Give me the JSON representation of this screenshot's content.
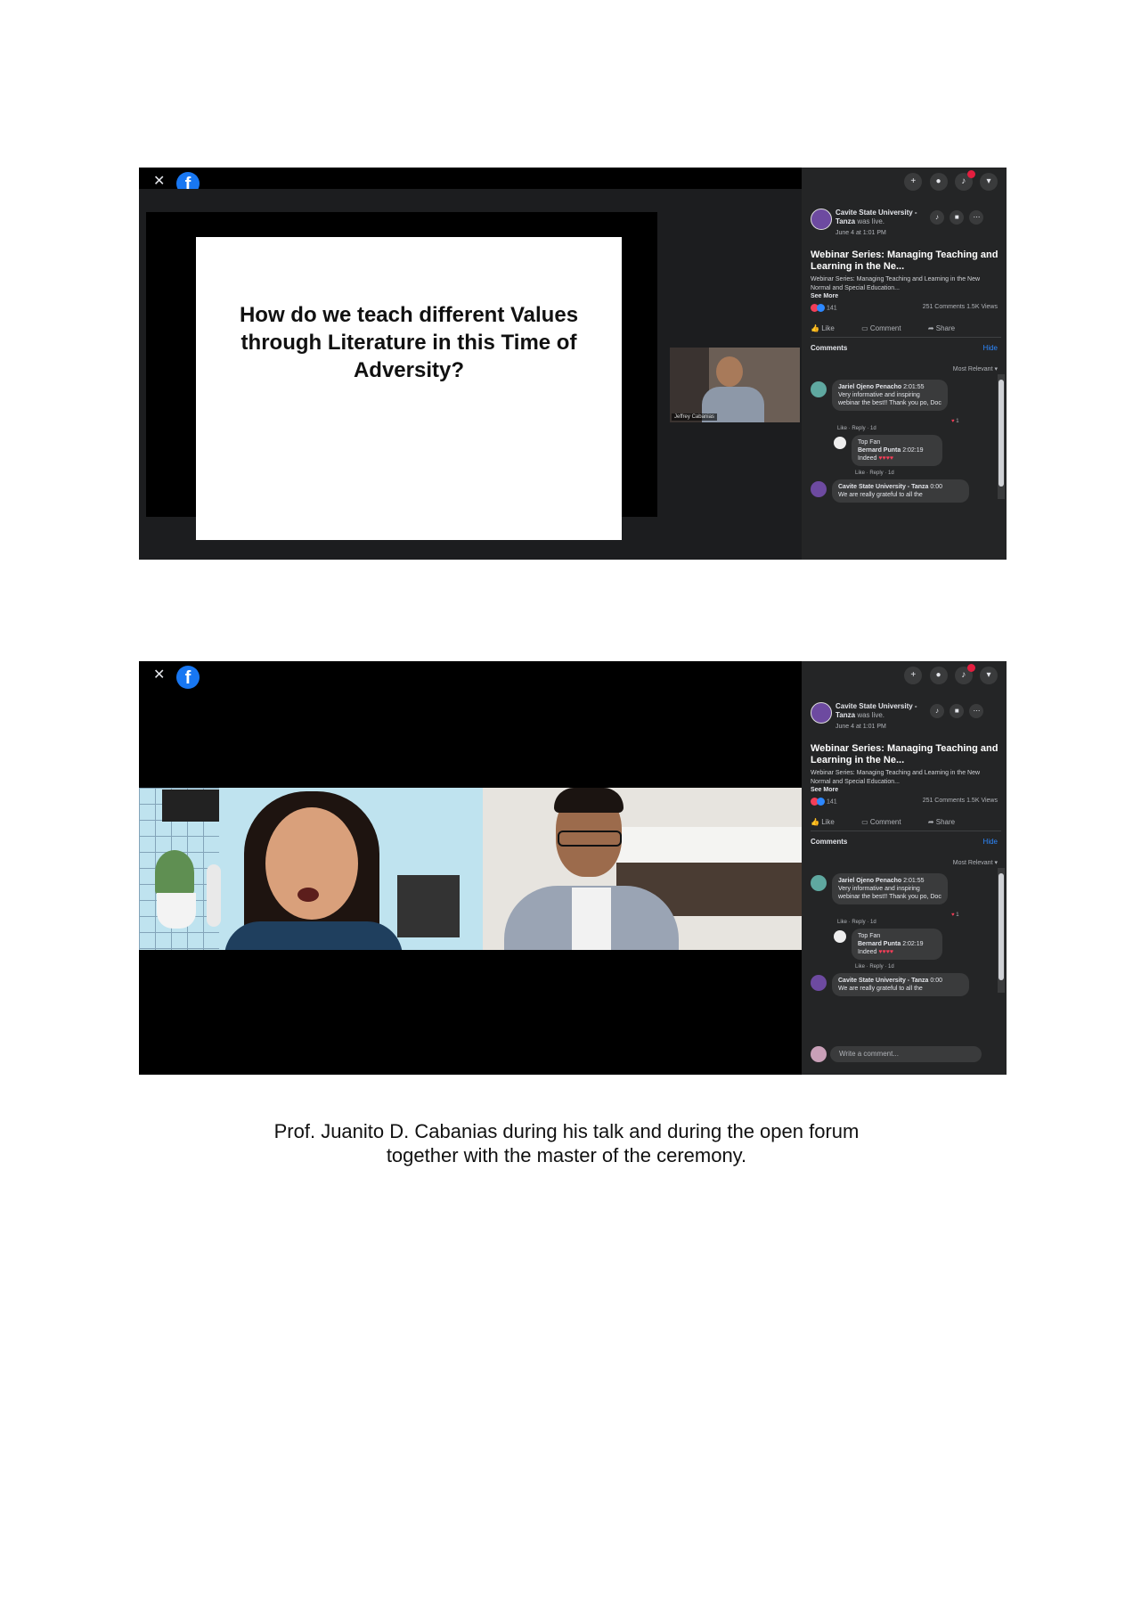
{
  "slide": {
    "question": "How do we teach different Values through Literature in this Time of Adversity?"
  },
  "pip": {
    "name_tag": "Jeffrey Cabanias"
  },
  "panel": {
    "page_name": "Cavite State University - Tanza",
    "page_suffix": "was live.",
    "date": "June 4 at 1:01 PM",
    "title": "Webinar Series: Managing Teaching and Learning in the Ne...",
    "description": "Webinar Series: Managing Teaching and Learning in the New Normal and Special Education...",
    "see_more": "See More",
    "reactions": "141",
    "stats": "251 Comments  1.5K Views",
    "actions": {
      "like": "Like",
      "comment": "Comment",
      "share": "Share"
    },
    "comments_label": "Comments",
    "hide_label": "Hide",
    "sort_label": "Most Relevant",
    "comment1": {
      "author": "Jariel Ojeno Penacho",
      "time": "2:01:55",
      "text": "Very informative and inspiring webinar the best!! Thank you po, Doc",
      "meta": "Like · Reply · 1d",
      "reaction_count": "1"
    },
    "reply": {
      "label": "Top Fan",
      "author": "Bernard Punta",
      "time": "2:02:19",
      "text": "Indeed",
      "meta": "Like · Reply · 1d"
    },
    "comment2": {
      "author": "Cavite State University - Tanza",
      "time": "0:00",
      "text": "We are really grateful to all the"
    },
    "write_placeholder": "Write a comment..."
  },
  "caption": {
    "line1": "Prof. Juanito D. Cabanias during his talk and during the open forum",
    "line2": "together with the master of the ceremony."
  }
}
